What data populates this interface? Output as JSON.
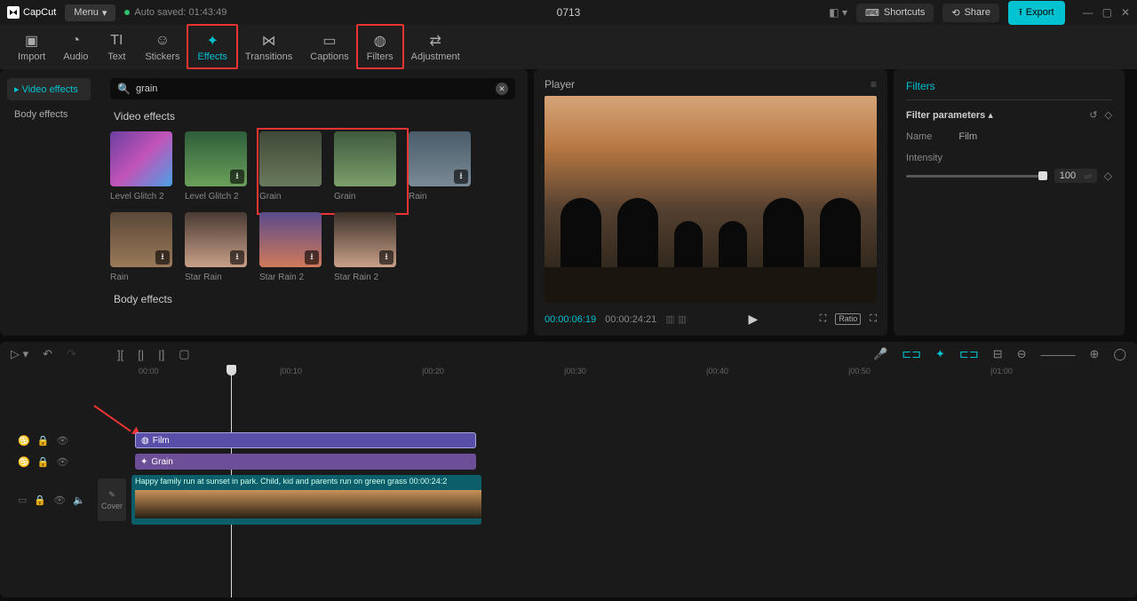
{
  "titlebar": {
    "app": "CapCut",
    "menu": "Menu",
    "autosave": "Auto saved: 01:43:49",
    "project": "0713",
    "shortcuts": "Shortcuts",
    "share": "Share",
    "export": "Export"
  },
  "toolbar": [
    {
      "label": "Import",
      "icon": "▣"
    },
    {
      "label": "Audio",
      "icon": "◔"
    },
    {
      "label": "Text",
      "icon": "TI"
    },
    {
      "label": "Stickers",
      "icon": "☺"
    },
    {
      "label": "Effects",
      "icon": "✦",
      "active": true,
      "box": true
    },
    {
      "label": "Transitions",
      "icon": "⋈"
    },
    {
      "label": "Captions",
      "icon": "▭"
    },
    {
      "label": "Filters",
      "icon": "◍",
      "box": true
    },
    {
      "label": "Adjustment",
      "icon": "⇄"
    }
  ],
  "sidebar": {
    "items": [
      {
        "label": "Video effects",
        "active": true
      },
      {
        "label": "Body effects"
      }
    ]
  },
  "search": {
    "value": "grain"
  },
  "sections": {
    "video_title": "Video effects",
    "body_title": "Body effects",
    "row1": [
      {
        "label": "Level Glitch 2",
        "bg": "linear-gradient(135deg,#6b3fa0,#c254b8,#4aa0e6)",
        "dl": false
      },
      {
        "label": "Level Glitch 2",
        "bg": "linear-gradient(#2e5e3a,#6ba05a)",
        "dl": true
      },
      {
        "label": "Grain",
        "bg": "linear-gradient(#3e4a38,#6a7a5c)",
        "dl": false
      },
      {
        "label": "Grain",
        "bg": "linear-gradient(#3f5a3e,#7aa06a)",
        "dl": false
      },
      {
        "label": "Rain",
        "bg": "linear-gradient(#4a5c6a,#7a8a96)",
        "dl": true
      }
    ],
    "row2": [
      {
        "label": "Rain",
        "bg": "linear-gradient(#5a4838,#9a7a5a)",
        "dl": true
      },
      {
        "label": "Star Rain",
        "bg": "linear-gradient(#4a3a34,#c9a088)",
        "dl": true
      },
      {
        "label": "Star Rain 2",
        "bg": "linear-gradient(#5a4a8a,#d07a5a)",
        "dl": true
      },
      {
        "label": "Star Rain 2",
        "bg": "linear-gradient(#3a3028,#c9a088)",
        "dl": true
      }
    ]
  },
  "player": {
    "title": "Player",
    "current": "00:00:06:19",
    "total": "00:00:24:21",
    "ratio": "Ratio"
  },
  "right": {
    "title": "Filters",
    "section": "Filter parameters",
    "name_k": "Name",
    "name_v": "Film",
    "intensity_k": "Intensity",
    "intensity_v": "100"
  },
  "ruler": [
    "00:00",
    "|00:10",
    "|00:20",
    "|00:30",
    "|00:40",
    "|00:50",
    "|01:00"
  ],
  "ruler_pos": [
    156,
    315,
    475,
    635,
    795,
    955,
    1115
  ],
  "tracks": {
    "film": "Film",
    "grain": "Grain",
    "video_label": "Happy family run at sunset in park. Child, kid and parents run on green grass   00:00:24:2",
    "cover": "Cover"
  }
}
